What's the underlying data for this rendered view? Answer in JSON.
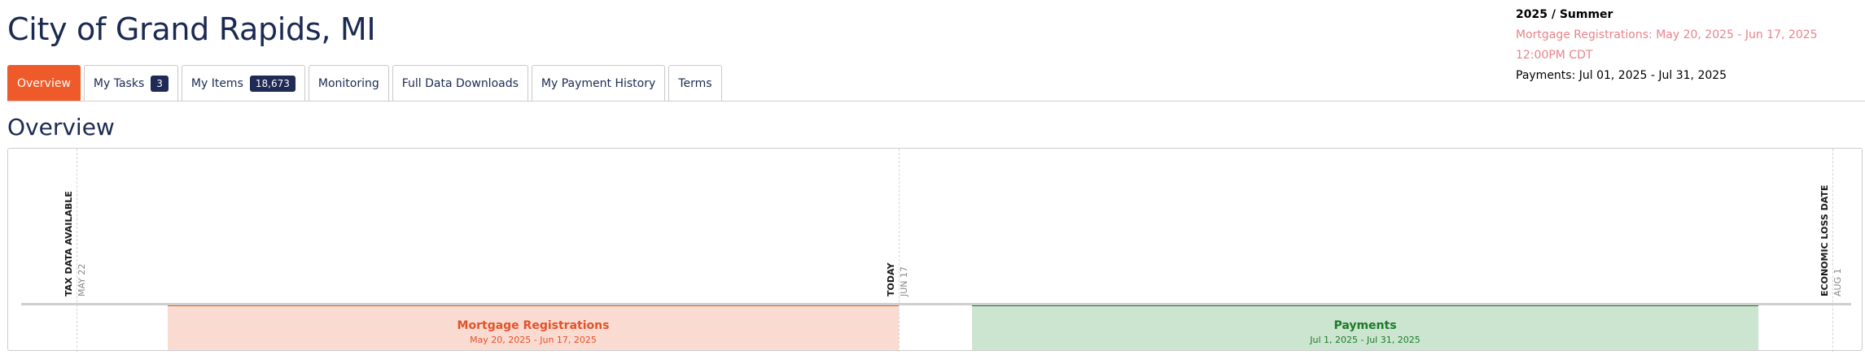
{
  "header": {
    "title": "City of Grand Rapids, MI"
  },
  "season": {
    "title": "2025 / Summer",
    "mortgage": "Mortgage Registrations: May 20, 2025 - Jun 17, 2025 12:00PM CDT",
    "payments": "Payments: Jul 01, 2025 - Jul 31, 2025"
  },
  "tabs": [
    {
      "label": "Overview",
      "active": true
    },
    {
      "label": "My Tasks",
      "badge": "3"
    },
    {
      "label": "My Items",
      "badge": "18,673"
    },
    {
      "label": "Monitoring"
    },
    {
      "label": "Full Data Downloads"
    },
    {
      "label": "My Payment History"
    },
    {
      "label": "Terms"
    }
  ],
  "section": {
    "title": "Overview"
  },
  "timeline": {
    "markers": [
      {
        "label": "TAX DATA AVAILABLE",
        "date": "MAY 22"
      },
      {
        "label": "TODAY",
        "date": "JUN 17"
      },
      {
        "label": "ECONOMIC LOSS DATE",
        "date": "AUG 1"
      }
    ],
    "bands": [
      {
        "name": "Mortgage Registrations",
        "dates": "May 20, 2025 - Jun 17, 2025",
        "color": "#ef5a2a"
      },
      {
        "name": "Payments",
        "dates": "Jul 1, 2025 - Jul 31, 2025",
        "color": "#1c7a28"
      }
    ]
  },
  "colors": {
    "accent": "#ef5a2a",
    "navy": "#1b2a52",
    "badge": "#1f2a55",
    "green": "#1c7a28"
  }
}
